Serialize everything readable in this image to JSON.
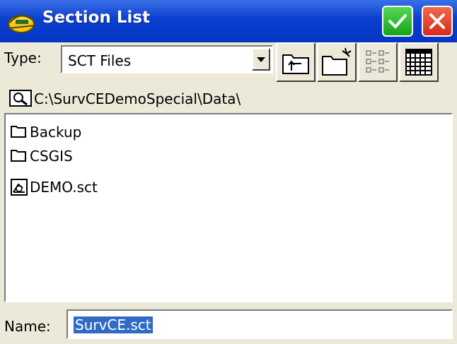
{
  "window": {
    "title": "Section List",
    "icon": "surveyor-helmet-icon",
    "ok_icon": "check-icon",
    "close_icon": "close-icon",
    "colors": {
      "titlebar": "#0a3fd0",
      "ok": "#16a316",
      "close": "#d92a1c"
    }
  },
  "type_filter": {
    "label": "Type:",
    "selected": "SCT Files"
  },
  "toolbar": {
    "buttons": [
      "parent-folder-icon",
      "new-folder-icon",
      "list-view-icon",
      "details-view-icon"
    ]
  },
  "path": {
    "icon": "folder-search-icon",
    "text": "C:\\SurvCEDemoSpecial\\Data\\"
  },
  "files": [
    {
      "name": "Backup",
      "icon": "folder-icon"
    },
    {
      "name": "CSGIS",
      "icon": "folder-icon"
    },
    {
      "name": "DEMO.sct",
      "icon": "section-file-icon"
    }
  ],
  "name_field": {
    "label": "Name:",
    "value": "SurvCE.sct"
  }
}
